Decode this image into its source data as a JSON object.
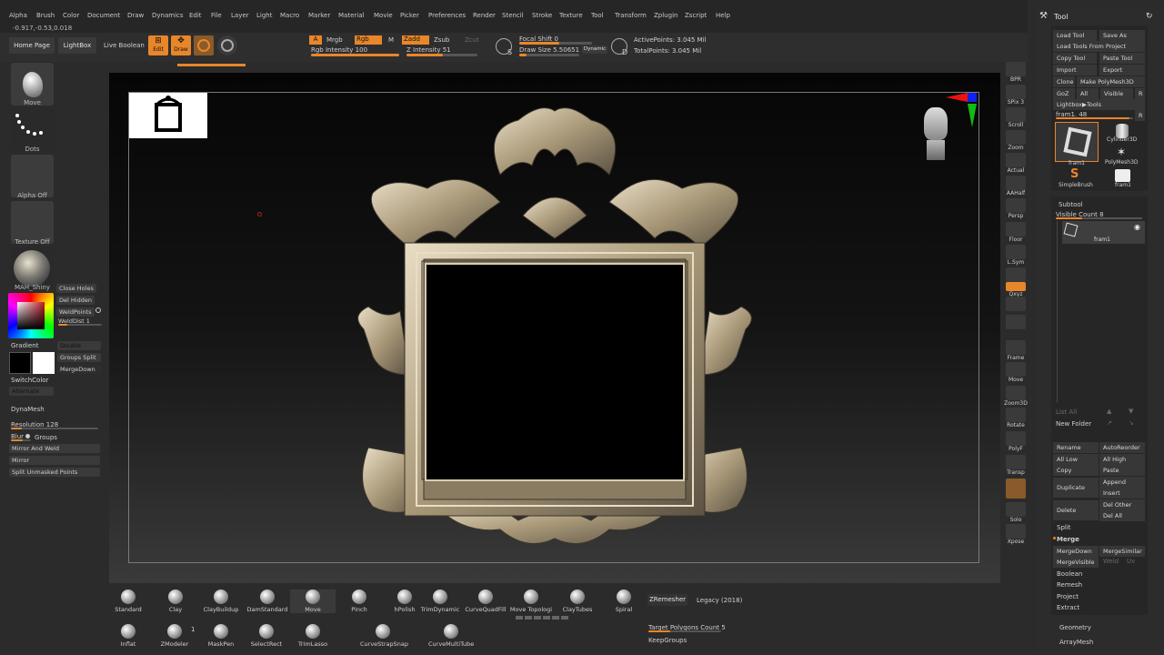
{
  "menubar": {
    "items": [
      "Alpha",
      "Brush",
      "Color",
      "Document",
      "Draw",
      "Dynamics",
      "Edit",
      "File",
      "Layer",
      "Light",
      "Macro",
      "Marker",
      "Material",
      "Movie",
      "Picker",
      "Preferences",
      "Render",
      "Stencil",
      "Stroke",
      "Texture",
      "Tool",
      "Transform",
      "Zplugin",
      "Zscript",
      "Help"
    ],
    "coords": "-0.917,-0.53,0.018"
  },
  "topbar": {
    "home_page": "Home Page",
    "lightbox": "LightBox",
    "live_boolean": "Live Boolean",
    "edit": "Edit",
    "draw": "Draw",
    "a": "A",
    "mrgb": "Mrgb",
    "rgb": "Rgb",
    "m": "M",
    "zadd": "Zadd",
    "zsub": "Zsub",
    "zcut": "Zcut",
    "rgb_intensity": "Rgb Intensity 100",
    "z_intensity": "Z Intensity 51",
    "focal_shift": "Focal Shift 0",
    "draw_size": "Draw Size 5.50651",
    "dynamic": "Dynamic",
    "active_points": "ActivePoints: 3.045 Mil",
    "total_points": "TotalPoints: 3.045 Mil",
    "s_label": "S",
    "d_label": "D"
  },
  "leftpanel": {
    "move": "Move",
    "dots": "Dots",
    "alpha_off": "Alpha Off",
    "texture_off": "Texture Off",
    "material": "MAH_Shiny",
    "close_holes": "Close Holes",
    "del_hidden": "Del Hidden",
    "weld_points": "WeldPoints",
    "weld_dist": "WeldDist 1",
    "gradient": "Gradient",
    "double": "Double",
    "groups_split": "Groups Split",
    "merge_down": "MergeDown",
    "switch_color": "SwitchColor",
    "alternate": "Alternate",
    "dynamesh": "DynaMesh",
    "resolution": "Resolution 128",
    "blur": "Blur",
    "groups": "Groups",
    "mirror_and_weld": "Mirror And Weld",
    "mirror": "Mirror",
    "split_unmasked": "Split Unmasked Points"
  },
  "rightbar": [
    "BPR",
    "SPix 3",
    "Scroll",
    "Zoom",
    "Actual",
    "AAHalf",
    "Persp",
    "Floor",
    "L.Sym",
    "",
    "Qxyz",
    "",
    "",
    "Frame",
    "Move",
    "Zoom3D",
    "Rotate",
    "PolyF",
    "Transp",
    "",
    "Solo",
    "Xpose"
  ],
  "toolpanel": {
    "title": "Tool",
    "load_tool": "Load Tool",
    "save_as": "Save As",
    "load_from_project": "Load Tools From Project",
    "copy_tool": "Copy Tool",
    "paste_tool": "Paste Tool",
    "import": "Import",
    "export": "Export",
    "clone": "Clone",
    "make_polymesh": "Make PolyMesh3D",
    "goz": "GoZ",
    "all": "All",
    "visible": "Visible",
    "r": "R",
    "lightbox_tools": "Lightbox▶Tools",
    "fram_value": "fram1. 48",
    "tools": [
      "fram1",
      "Cylinder3D",
      "PolyMesh3D",
      "SimpleBrush",
      "fram1"
    ],
    "subtool": "Subtool",
    "visible_count": "Visible Count 8",
    "subtool_name": "fram1",
    "list_all": "List All",
    "new_folder": "New Folder",
    "rename": "Rename",
    "auto_reorder": "AutoReorder",
    "all_low": "All Low",
    "all_high": "All High",
    "copy": "Copy",
    "paste": "Paste",
    "duplicate": "Duplicate",
    "append": "Append",
    "insert": "Insert",
    "delete": "Delete",
    "del_other": "Del Other",
    "del_all": "Del All",
    "split": "Split",
    "merge": "Merge",
    "merge_down": "MergeDown",
    "merge_similar": "MergeSimilar",
    "merge_visible": "MergeVisible",
    "weld": "Weld",
    "uv": "Uv",
    "boolean": "Boolean",
    "remesh": "Remesh",
    "project": "Project",
    "extract": "Extract",
    "geometry": "Geometry",
    "arraymesh": "ArrayMesh"
  },
  "brushes_row1": [
    "Standard",
    "Clay",
    "ClayBuildup",
    "DamStandard",
    "Move",
    "Pinch",
    "hPolish",
    "TrimDynamic",
    "CurveQuadFill",
    "Move Topologi",
    "ClayTubes",
    "Spiral"
  ],
  "brushes_row2": [
    "Inflat",
    "ZModeler",
    "MaskPen",
    "SelectRect",
    "TrimLasso",
    "CurveStrapSnap",
    "CurveMultiTube"
  ],
  "zmodeler_count": "1",
  "zremesher": {
    "button": "ZRemesher",
    "legacy": "Legacy (2018)",
    "target": "Target Polygons Count 5",
    "keep_groups": "KeepGroups"
  },
  "colors": {
    "accent": "#e8862a",
    "frame_gold": "#b9a888"
  }
}
